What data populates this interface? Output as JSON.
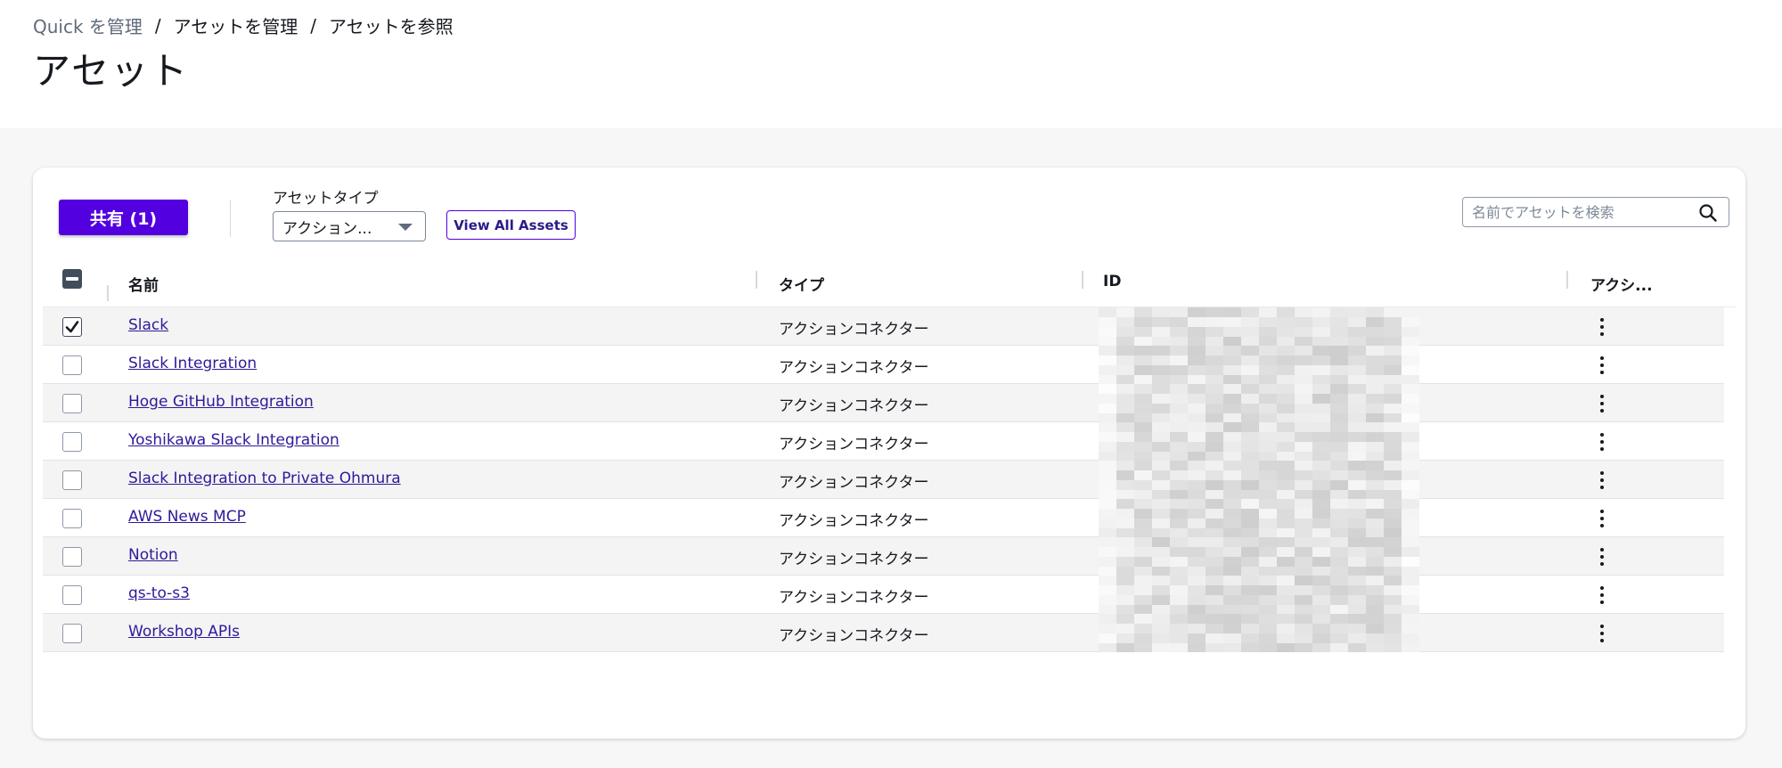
{
  "breadcrumb": {
    "items": [
      "Quick を管理",
      "アセットを管理",
      "アセットを参照"
    ],
    "separator": "/"
  },
  "page": {
    "title": "アセット"
  },
  "toolbar": {
    "share_label": "共有 (1)",
    "asset_type_label": "アセットタイプ",
    "asset_type_value": "アクション...",
    "view_all_label": "View All Assets",
    "search_placeholder": "名前でアセットを検索"
  },
  "table": {
    "headers": {
      "name": "名前",
      "type": "タイプ",
      "id": "ID",
      "actions": "アクシ..."
    },
    "rows": [
      {
        "name": "Slack",
        "type": "アクションコネクター",
        "checked": true
      },
      {
        "name": "Slack Integration",
        "type": "アクションコネクター",
        "checked": false
      },
      {
        "name": "Hoge GitHub Integration",
        "type": "アクションコネクター",
        "checked": false
      },
      {
        "name": "Yoshikawa Slack Integration",
        "type": "アクションコネクター",
        "checked": false
      },
      {
        "name": "Slack Integration to Private Ohmura",
        "type": "アクションコネクター",
        "checked": false
      },
      {
        "name": "AWS News MCP",
        "type": "アクションコネクター",
        "checked": false
      },
      {
        "name": "Notion",
        "type": "アクションコネクター",
        "checked": false
      },
      {
        "name": "qs-to-s3",
        "type": "アクションコネクター",
        "checked": false
      },
      {
        "name": "Workshop APIs",
        "type": "アクションコネクター",
        "checked": false
      }
    ]
  },
  "colors": {
    "primary": "#5300e0",
    "link": "#2d1a9a",
    "text": "#16191f"
  },
  "icons": {
    "search": "search-icon",
    "row_actions": "more-vertical-icon",
    "dropdown": "caret-down-icon"
  }
}
